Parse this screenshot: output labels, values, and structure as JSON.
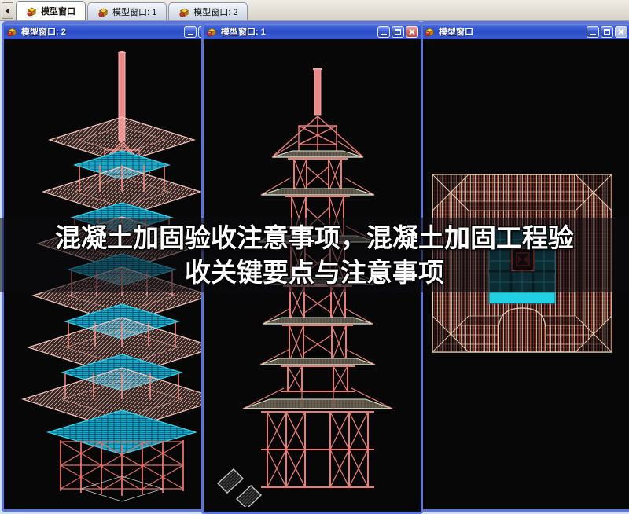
{
  "tab_bar": {
    "tabs": [
      {
        "label": "模型窗口",
        "active": true
      },
      {
        "label": "模型窗口: 1",
        "active": false
      },
      {
        "label": "模型窗口: 2",
        "active": false
      }
    ]
  },
  "windows": {
    "left": {
      "title": "模型窗口: 2",
      "view": "3d-perspective-wireframe-pagoda"
    },
    "middle": {
      "title": "模型窗口: 1",
      "view": "front-elevation-wireframe-pagoda"
    },
    "right": {
      "title": "模型窗口",
      "view": "top-plan-wireframe-pagoda"
    }
  },
  "overlay": {
    "line1": "混凝土加固验收注意事项，混凝土加固工程验",
    "line2": "收关键要点与注意事项"
  },
  "icons": {
    "tab_scroll_left": "chevron-left-icon",
    "window_badge": "model-window-icon",
    "minimize": "minimize-icon",
    "maximize": "maximize-icon",
    "close": "close-icon",
    "ucs": "ucs-axis-icon"
  },
  "colors": {
    "titlebar_blue": "#2a4cc4",
    "close_red": "#d96a5e",
    "disabled_close": "#9db1e6",
    "wireframe_salmon": "#ea7c74",
    "roof_pink": "#f2c6bc",
    "deck_cyan": "#25d2e6",
    "eave_green": "#cfe6c6",
    "plan_cream": "#ead8b8",
    "canvas_black": "#070707",
    "mdi_background": "#cfe0f5",
    "overlay_band": "rgba(11,11,16,0.56)",
    "overlay_text": "#ffffff"
  }
}
